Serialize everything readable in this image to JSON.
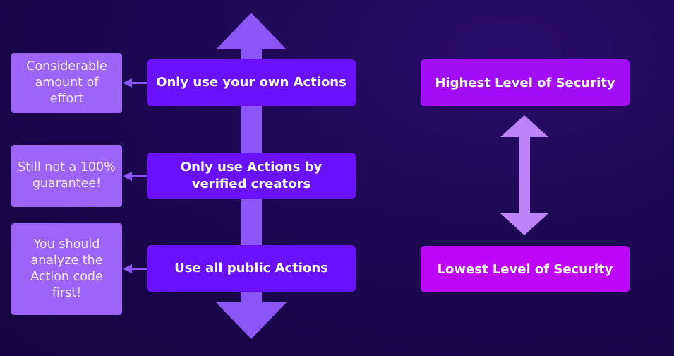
{
  "colors": {
    "main_box": "#6a11ff",
    "note_box": "#9c64f8",
    "axis_arrow": "#8b55f8",
    "high_box": "#a30cf7",
    "low_box": "#bd06f8",
    "range_arrow": "#bd84f8"
  },
  "steps": [
    {
      "label": "Only use your own Actions",
      "note": "Considerable amount of effort"
    },
    {
      "label": "Only use Actions by verified creators",
      "note": "Still not a 100% guarantee!"
    },
    {
      "label": "Use all public Actions",
      "note": "You should analyze the Action code first!"
    }
  ],
  "levels": {
    "high": "Highest Level of Security",
    "low": "Lowest Level of Security"
  }
}
